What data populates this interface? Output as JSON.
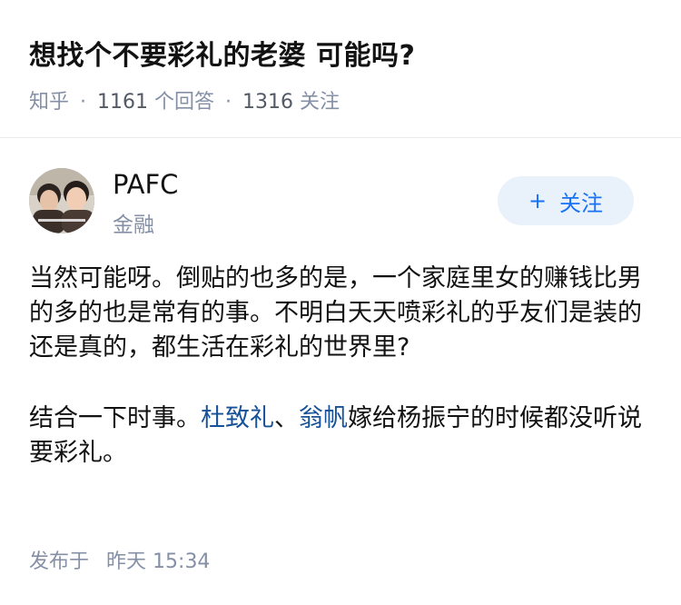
{
  "question": {
    "title": "想找个不要彩礼的老婆 可能吗?",
    "source": "知乎",
    "answers_count": "1161",
    "answers_label": "个回答",
    "followers_count": "1316",
    "followers_label": "关注",
    "separator": "·"
  },
  "author": {
    "name": "PAFC",
    "field": "金融",
    "follow_plus": "+",
    "follow_label": "关注"
  },
  "answer": {
    "paragraph1": "当然可能呀。倒贴的也多的是，一个家庭里女的赚钱比男的多的也是常有的事。不明白天天喷彩礼的乎友们是装的还是真的，都生活在彩礼的世界里?",
    "p2_prefix": "结合一下时事。",
    "p2_link1": "杜致礼",
    "p2_sep": "、",
    "p2_link2": "翁帆",
    "p2_suffix": "嫁给杨振宁的时候都没听说要彩礼。"
  },
  "footer": {
    "publish_label": "发布于",
    "publish_day": "昨天",
    "publish_time": "15:34"
  }
}
